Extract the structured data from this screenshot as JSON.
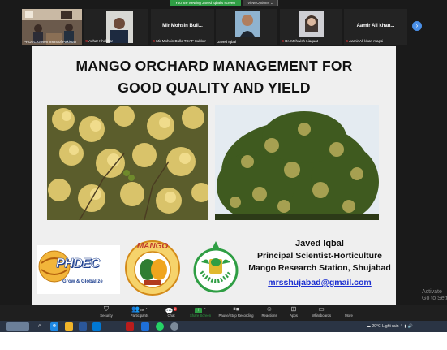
{
  "banner": {
    "viewing_text": "You are viewing Javed Iqbal's screen",
    "view_options_label": "View Options"
  },
  "participants": [
    {
      "label": "PHDEC Government of Pakistan",
      "muted": false
    },
    {
      "label": "Azhar Khokhar",
      "muted": true
    },
    {
      "big_name": "Mir Mohsin Bull...",
      "label": "Mir Mohsin Bullo TDAP Sukkur",
      "muted": true
    },
    {
      "label": "Javed Iqbal",
      "muted": false
    },
    {
      "label": "Dr. Mehwish Liaquat",
      "muted": true
    },
    {
      "big_name": "Aamir Ali khan...",
      "label": "Aamir Ali khan magsi",
      "muted": true
    }
  ],
  "slide": {
    "title_line1": "MANGO ORCHARD MANAGEMENT FOR",
    "title_line2": "GOOD QUALITY AND YIELD",
    "presenter_name": "Javed Iqbal",
    "presenter_title": "Principal Scientist-Horticulture",
    "organization": "Mango Research Station, Shujabad",
    "email": "mrsshujabad@gmail.com",
    "logos": {
      "phdec_name": "PHDEC",
      "phdec_tagline": "Grow & Globalize",
      "mri_top_text": "MANGO",
      "mrs_ring_text": "Mango Research Station, Shujabad"
    }
  },
  "watermark": {
    "line1": "Activate",
    "line2": "Go to Settings"
  },
  "toolbar": {
    "items": [
      {
        "label": "Security",
        "icon": "shield-icon"
      },
      {
        "label": "Participants",
        "count": "59",
        "icon": "participants-icon"
      },
      {
        "label": "Chat",
        "badge": "2",
        "icon": "chat-icon"
      },
      {
        "label": "Share Screen",
        "icon": "share-screen-icon"
      },
      {
        "label": "Pause/Stop Recording",
        "icon": "recording-icon"
      },
      {
        "label": "Reactions",
        "icon": "reactions-icon"
      },
      {
        "label": "Apps",
        "icon": "apps-icon"
      },
      {
        "label": "Whiteboards",
        "icon": "whiteboard-icon"
      },
      {
        "label": "More",
        "icon": "more-icon"
      }
    ]
  },
  "taskbar": {
    "weather": "20°C  Light rain"
  },
  "colors": {
    "share_green": "#2f9e44",
    "email_blue": "#1d2fd1",
    "toolbar_bg": "#1f1f1f",
    "slide_bg": "#efefef"
  }
}
